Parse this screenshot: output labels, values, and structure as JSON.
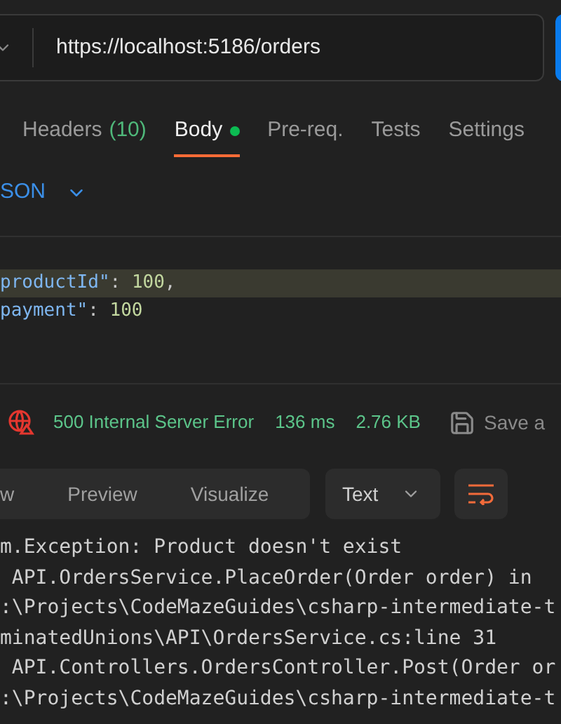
{
  "request": {
    "url": "https://localhost:5186/orders"
  },
  "tabs": [
    {
      "label": "Headers",
      "count": "(10)",
      "selected": false,
      "modified": false
    },
    {
      "label": "Body",
      "selected": true,
      "modified": true
    },
    {
      "label": "Pre-req.",
      "selected": false,
      "modified": false
    },
    {
      "label": "Tests",
      "selected": false,
      "modified": false
    },
    {
      "label": "Settings",
      "selected": false,
      "modified": false
    }
  ],
  "body_format": "SON",
  "body_lines": [
    {
      "key": "productId\"",
      "sep": ": ",
      "value": "100",
      "tail": ",",
      "highlighted": true
    },
    {
      "key": "payment\"",
      "sep": ": ",
      "value": "100",
      "highlighted": false
    }
  ],
  "response": {
    "status": "500 Internal Server Error",
    "time": "136 ms",
    "size": "2.76 KB",
    "save_label": "Save a",
    "view_tabs": [
      {
        "label": "w",
        "selected": false
      },
      {
        "label": "Preview",
        "selected": false
      },
      {
        "label": "Visualize",
        "selected": false
      }
    ],
    "format": "Text",
    "lines": [
      "m.Exception: Product doesn't exist",
      " API.OrdersService.PlaceOrder(Order order) in",
      ":\\Projects\\CodeMazeGuides\\csharp-intermediate-t",
      "minatedUnions\\API\\OrdersService.cs:line 31",
      " API.Controllers.OrdersController.Post(Order or",
      ":\\Projects\\CodeMazeGuides\\csharp-intermediate-t"
    ]
  }
}
